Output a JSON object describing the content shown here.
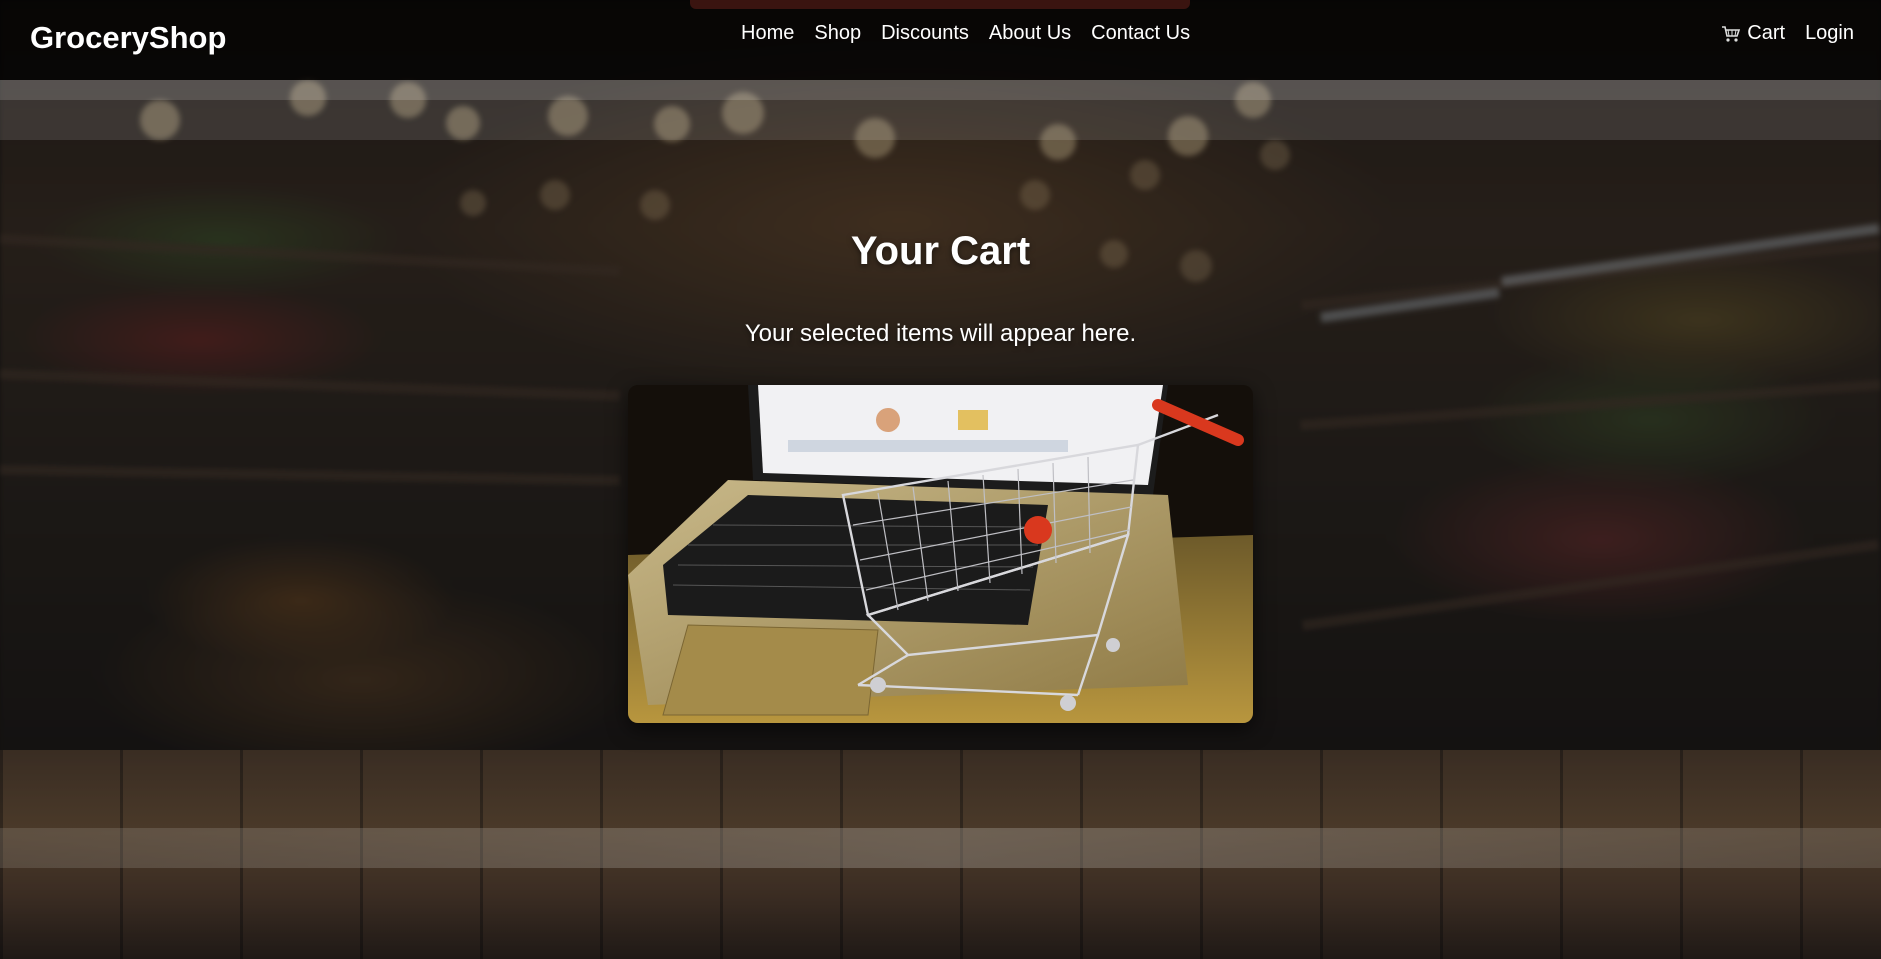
{
  "brand": "GroceryShop",
  "nav": {
    "links": [
      "Home",
      "Shop",
      "Discounts",
      "About Us",
      "Contact Us"
    ],
    "cart_label": "Cart",
    "login_label": "Login"
  },
  "main": {
    "title": "Your Cart",
    "subtitle": "Your selected items will appear here."
  },
  "icons": {
    "cart": "shopping-cart-icon",
    "hero_image": "laptop-with-shopping-cart-image"
  },
  "colors": {
    "navbar_bg": "#000000b8",
    "text": "#ffffff",
    "cart_handle": "#d9381e"
  }
}
